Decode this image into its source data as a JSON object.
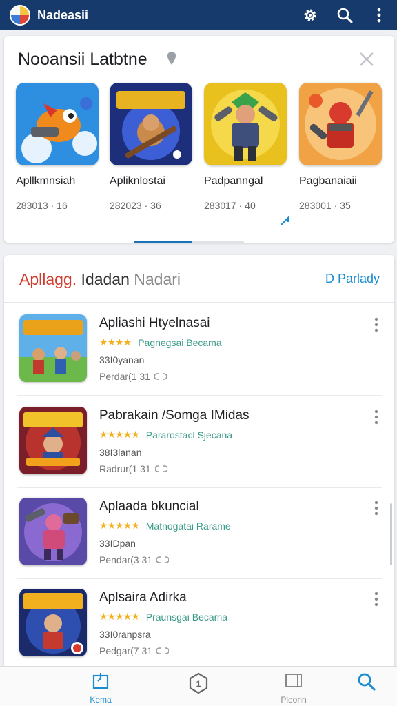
{
  "appbar": {
    "title": "Nadeasii",
    "icons": [
      "settings-gear-icon",
      "search-icon",
      "more-vert-icon"
    ],
    "bg_color": "#163a6b"
  },
  "featured": {
    "title": "Nooansii Latbtne",
    "items": [
      {
        "name": "Apllkmnsiah",
        "date": "283013 · 16"
      },
      {
        "name": "Apliknlostai",
        "date": "282023 · 36"
      },
      {
        "name": "Padpanngal",
        "date": "283017 · 40"
      },
      {
        "name": "Pagbanaiaii",
        "date": "283001 · 35"
      }
    ]
  },
  "list": {
    "title_part1": "Apllagg.",
    "title_part2": "Idadan",
    "title_part3": "Nadari",
    "link": "D Parlady",
    "rows": [
      {
        "title": "Apliashi Htyelnasai",
        "stars": "★★★★",
        "category": "Pagnegsai Becama",
        "size": "33I0yanan",
        "meta": "Perdar(1 31"
      },
      {
        "title": "Pabrakain /Somga IMidas",
        "stars": "★★★★★",
        "category": "Pararostacl Sjecana",
        "size": "38I3lanan",
        "meta": "Radrur(1 31"
      },
      {
        "title": "Aplaada bkuncial",
        "stars": "★★★★★",
        "category": "Matnogatai Rarame",
        "size": "33IDpan",
        "meta": "Pendar(3 31"
      },
      {
        "title": "Aplsaira Adirka",
        "stars": "★★★★★",
        "category": "Praunsgai Becama",
        "size": "33I0ranpsra",
        "meta": "Pedgar(7 31"
      }
    ]
  },
  "bottomnav": {
    "items": [
      {
        "label": "Kema",
        "icon": "home-icon",
        "color": "#1a8ccf"
      },
      {
        "label": "",
        "icon": "updates-shield-icon",
        "color": "#666666"
      },
      {
        "label": "Pleonn",
        "icon": "library-icon",
        "color": "#888888"
      },
      {
        "label": "",
        "icon": "search-icon",
        "color": "#1a8ccf"
      }
    ]
  }
}
